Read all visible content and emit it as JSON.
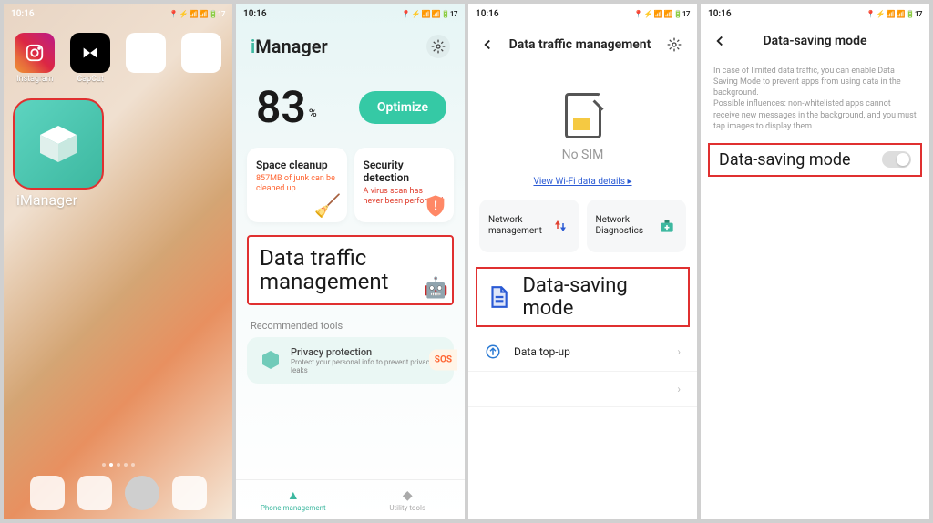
{
  "status": {
    "time": "10:16",
    "icons_text": "📍 ⚡ 📶 📶 🔋17"
  },
  "panel1": {
    "apps": {
      "instagram": "Instagram",
      "capcut": "CapCut",
      "imanager": "iManager"
    }
  },
  "panel2": {
    "title_i": "i",
    "title_rest": "Manager",
    "score": "83",
    "pct": "%",
    "optimize": "Optimize",
    "space": {
      "title": "Space cleanup",
      "sub": "857MB of junk can be cleaned up"
    },
    "security": {
      "title": "Security detection",
      "sub": "A virus scan has never been performed"
    },
    "big_card": "Data traffic management",
    "rec_title": "Recommended tools",
    "privacy_title": "Privacy protection",
    "privacy_sub": "Protect your personal info to prevent privacy leaks",
    "sos": "SOS",
    "tab1": "Phone management",
    "tab2": "Utility tools"
  },
  "panel3": {
    "title": "Data traffic management",
    "no_sim": "No SIM",
    "wifi_link": "View Wi-Fi data details",
    "netmgmt": "Network management",
    "netdiag": "Network Diagnostics",
    "dsm": "Data-saving mode",
    "topup": "Data top-up"
  },
  "panel4": {
    "title": "Data-saving mode",
    "info": "In case of limited data traffic, you can enable Data Saving Mode to prevent apps from using data in the background.\nPossible influences: non-whitelisted apps cannot receive new messages in the background, and you must tap images to display them.",
    "toggle_label": "Data-saving mode"
  }
}
